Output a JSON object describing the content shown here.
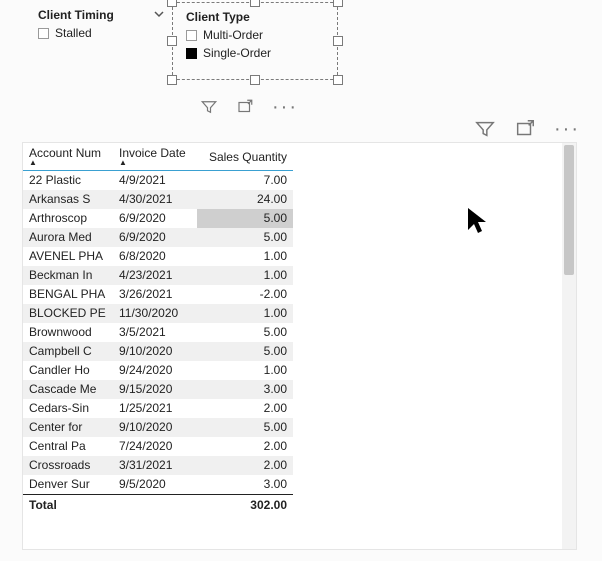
{
  "slicer_timing": {
    "title": "Client Timing",
    "items": [
      "Stalled"
    ]
  },
  "slicer_type": {
    "title": "Client Type",
    "items": [
      "Multi-Order",
      "Single-Order"
    ]
  },
  "table": {
    "headers": [
      "Account Num",
      "Invoice Date",
      "Sales Quantity"
    ],
    "rows": [
      {
        "acct": "22 Plastic",
        "date": "4/9/2021",
        "qty": "7.00"
      },
      {
        "acct": "Arkansas S",
        "date": "4/30/2021",
        "qty": "24.00"
      },
      {
        "acct": "Arthroscop",
        "date": "6/9/2020",
        "qty": "5.00",
        "highlight": true
      },
      {
        "acct": "Aurora Med",
        "date": "6/9/2020",
        "qty": "5.00"
      },
      {
        "acct": "AVENEL PHA",
        "date": "6/8/2020",
        "qty": "1.00"
      },
      {
        "acct": "Beckman In",
        "date": "4/23/2021",
        "qty": "1.00"
      },
      {
        "acct": "BENGAL PHA",
        "date": "3/26/2021",
        "qty": "-2.00"
      },
      {
        "acct": "BLOCKED PE",
        "date": "11/30/2020",
        "qty": "1.00"
      },
      {
        "acct": "Brownwood",
        "date": "3/5/2021",
        "qty": "5.00"
      },
      {
        "acct": "Campbell C",
        "date": "9/10/2020",
        "qty": "5.00"
      },
      {
        "acct": "Candler Ho",
        "date": "9/24/2020",
        "qty": "1.00"
      },
      {
        "acct": "Cascade Me",
        "date": "9/15/2020",
        "qty": "3.00"
      },
      {
        "acct": "Cedars-Sin",
        "date": "1/25/2021",
        "qty": "2.00"
      },
      {
        "acct": "Center for",
        "date": "9/10/2020",
        "qty": "5.00"
      },
      {
        "acct": "Central Pa",
        "date": "7/24/2020",
        "qty": "2.00"
      },
      {
        "acct": "Crossroads",
        "date": "3/31/2021",
        "qty": "2.00"
      },
      {
        "acct": "Denver Sur",
        "date": "9/5/2020",
        "qty": "3.00"
      }
    ],
    "total_label": "Total",
    "total_qty": "302.00"
  }
}
